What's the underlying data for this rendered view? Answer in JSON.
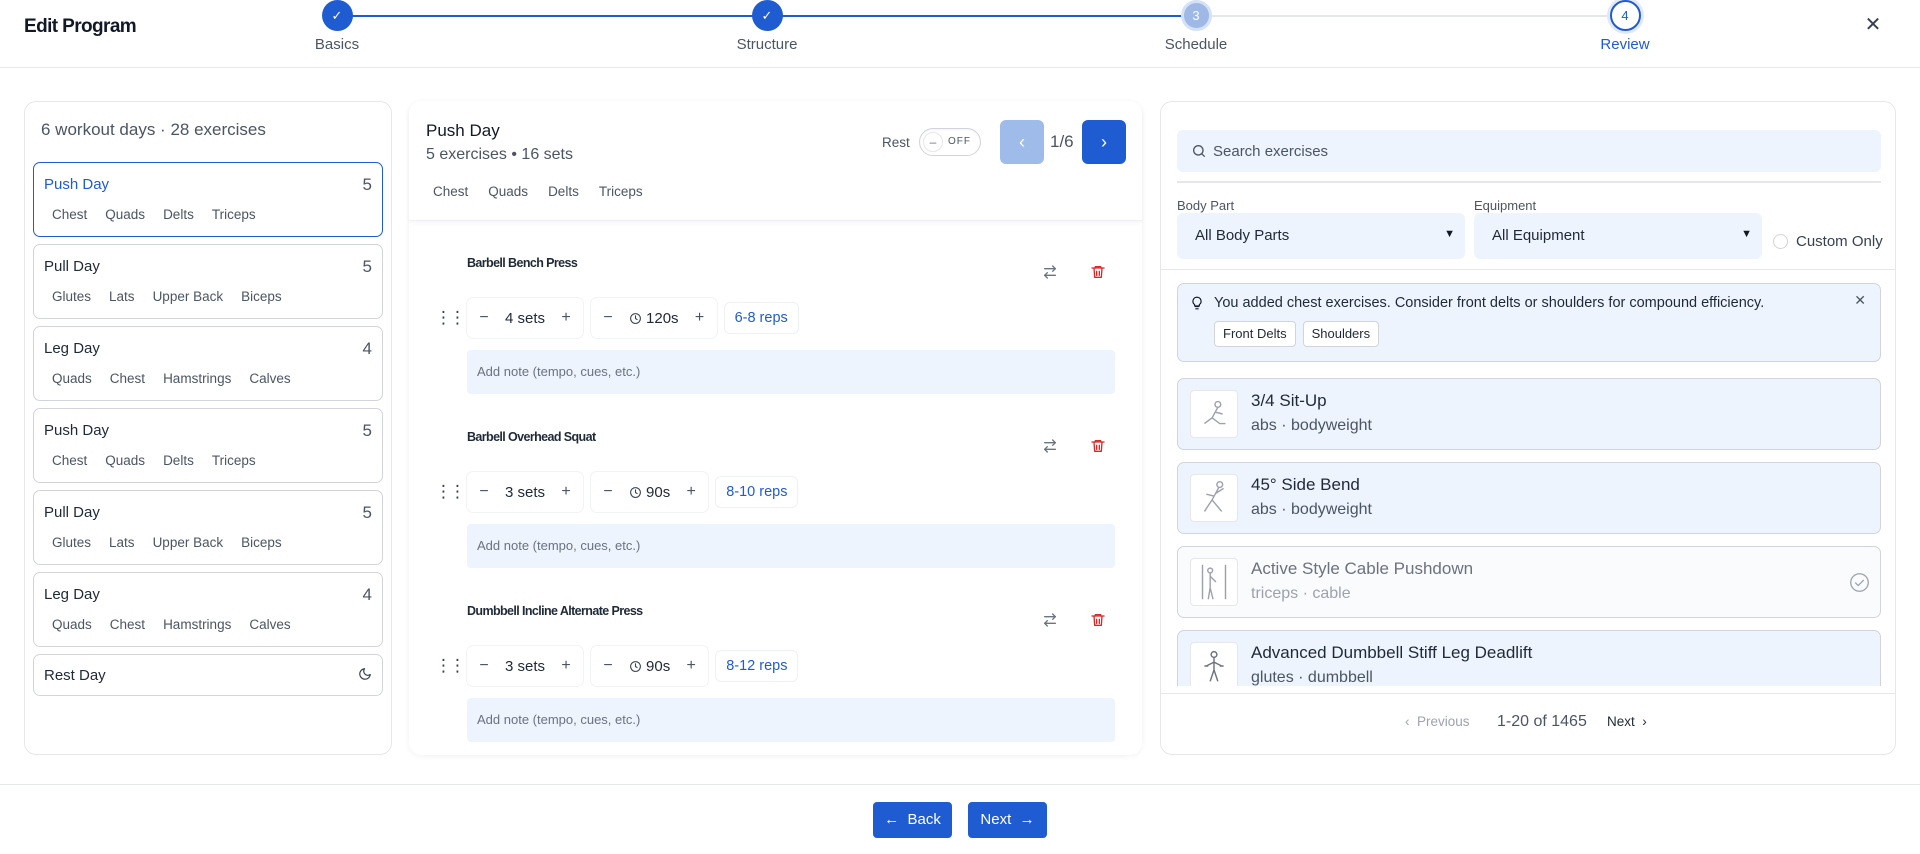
{
  "header": {
    "title": "Edit Program",
    "steps": [
      {
        "label": "Basics",
        "marker": "✓"
      },
      {
        "label": "Structure",
        "marker": "✓"
      },
      {
        "label": "Schedule",
        "marker": "3"
      },
      {
        "label": "Review",
        "marker": "4"
      }
    ],
    "close_icon": "close-icon"
  },
  "days_panel": {
    "summary": "6 workout days · 28 exercises",
    "days": [
      {
        "name": "Push Day",
        "count": "5",
        "tags": [
          "Chest",
          "Quads",
          "Delts",
          "Triceps"
        ]
      },
      {
        "name": "Pull Day",
        "count": "5",
        "tags": [
          "Glutes",
          "Lats",
          "Upper Back",
          "Biceps"
        ]
      },
      {
        "name": "Leg Day",
        "count": "4",
        "tags": [
          "Quads",
          "Chest",
          "Hamstrings",
          "Calves"
        ]
      },
      {
        "name": "Push Day",
        "count": "5",
        "tags": [
          "Chest",
          "Quads",
          "Delts",
          "Triceps"
        ]
      },
      {
        "name": "Pull Day",
        "count": "5",
        "tags": [
          "Glutes",
          "Lats",
          "Upper Back",
          "Biceps"
        ]
      },
      {
        "name": "Leg Day",
        "count": "4",
        "tags": [
          "Quads",
          "Chest",
          "Hamstrings",
          "Calves"
        ]
      }
    ],
    "rest_day": "Rest Day"
  },
  "day_editor": {
    "title": "Push Day",
    "subtitle": "5 exercises • 16 sets",
    "tags": [
      "Chest",
      "Quads",
      "Delts",
      "Triceps"
    ],
    "rest_label": "Rest",
    "rest_toggle_text": "OFF",
    "rest_toggle_knob": "–",
    "pager_text": "1/6",
    "exercises": [
      {
        "name": "Barbell Bench Press",
        "sets": "4 sets",
        "rest": "120s",
        "reps": "6-8 reps",
        "note_placeholder": "Add note (tempo, cues, etc.)"
      },
      {
        "name": "Barbell Overhead Squat",
        "sets": "3 sets",
        "rest": "90s",
        "reps": "8-10 reps",
        "note_placeholder": "Add note (tempo, cues, etc.)"
      },
      {
        "name": "Dumbbell Incline Alternate Press",
        "sets": "3 sets",
        "rest": "90s",
        "reps": "8-12 reps",
        "note_placeholder": "Add note (tempo, cues, etc.)"
      }
    ]
  },
  "library": {
    "search_placeholder": "Search exercises",
    "body_part_label": "Body Part",
    "body_part_value": "All Body Parts",
    "equipment_label": "Equipment",
    "equipment_value": "All Equipment",
    "custom_only_label": "Custom Only",
    "tip_text": "You added chest exercises. Consider front delts or shoulders for compound efficiency.",
    "tip_chips": [
      "Front Delts",
      "Shoulders"
    ],
    "items": [
      {
        "name": "3/4 Sit-Up",
        "meta": "abs · bodyweight",
        "added": false
      },
      {
        "name": "45° Side Bend",
        "meta": "abs · bodyweight",
        "added": false
      },
      {
        "name": "Active Style Cable Pushdown",
        "meta": "triceps · cable",
        "added": true
      },
      {
        "name": "Advanced Dumbbell Stiff Leg Deadlift",
        "meta": "glutes · dumbbell",
        "added": false
      }
    ],
    "pagination": {
      "previous": "Previous",
      "range": "1-20 of 1465",
      "next": "Next"
    }
  },
  "footer": {
    "back": "Back",
    "next": "Next"
  },
  "colors": {
    "accent": "#1f5cd1",
    "accent_light": "#9fbbe9",
    "tint": "#eef4fd",
    "danger": "#dc2626"
  }
}
